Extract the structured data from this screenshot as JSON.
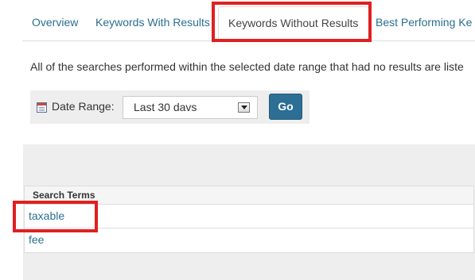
{
  "tabs": [
    {
      "label": "Overview"
    },
    {
      "label": "Keywords With Results"
    },
    {
      "label": "Keywords Without Results"
    },
    {
      "label": "Best Performing Ke"
    }
  ],
  "description": "All of the searches performed within the selected date range that had no results are liste",
  "date_range": {
    "label": "Date Range:",
    "selected": "Last 30 davs",
    "go_label": "Go"
  },
  "results": {
    "header": "Search Terms",
    "rows": [
      "taxable",
      "fee"
    ]
  },
  "colors": {
    "highlight": "#e02020",
    "link": "#2a6f8f",
    "go_button": "#2d6e94"
  }
}
